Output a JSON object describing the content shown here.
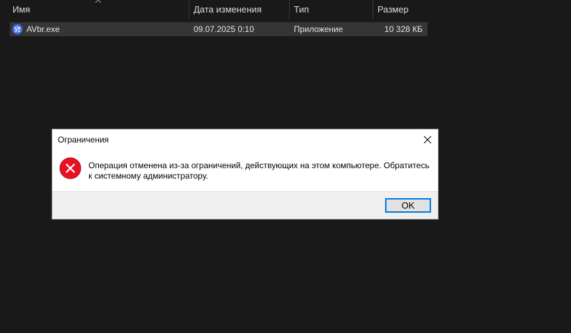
{
  "explorer": {
    "columns": {
      "name": "Имя",
      "date": "Дата изменения",
      "type": "Тип",
      "size": "Размер"
    },
    "files": [
      {
        "icon": "application-icon",
        "name": "AVbr.exe",
        "date": "09.07.2025 0:10",
        "type": "Приложение",
        "size": "10 328 КБ"
      }
    ]
  },
  "dialog": {
    "title": "Ограничения",
    "message": "Операция отменена из-за ограничений, действующих на этом компьютере. Обратитесь к системному администратору.",
    "ok_label": "OK",
    "icon": "error-icon",
    "error_color": "#e81123",
    "accent_color": "#0078d7"
  }
}
